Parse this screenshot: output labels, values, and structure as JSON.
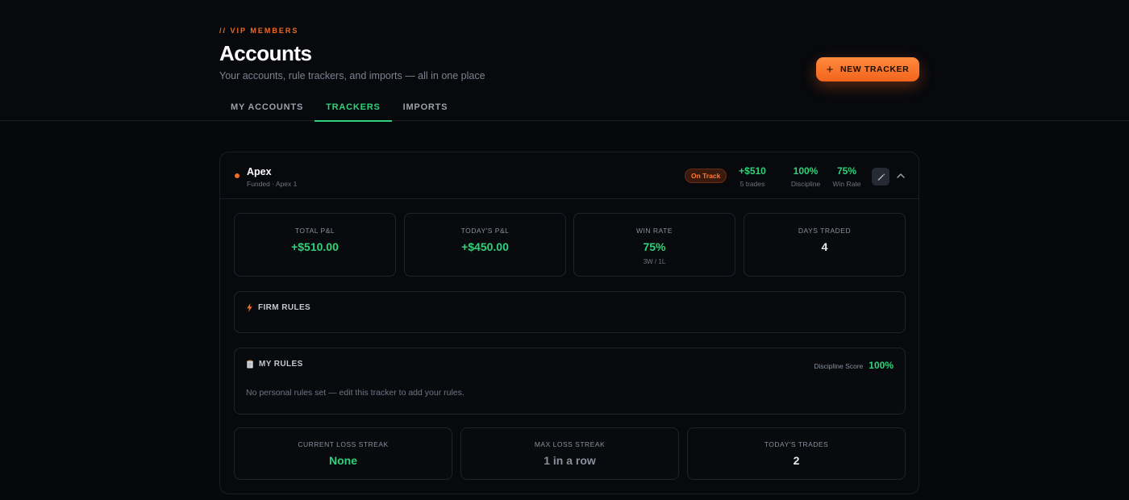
{
  "header": {
    "eyebrow": "// VIP MEMBERS",
    "title": "Accounts",
    "subtitle": "Your accounts, rule trackers, and imports — all in one place",
    "new_tracker_label": "NEW TRACKER",
    "new_tracker_icon": "plus-icon"
  },
  "tabs": [
    {
      "label": "MY ACCOUNTS",
      "active": false
    },
    {
      "label": "TRACKERS",
      "active": true
    },
    {
      "label": "IMPORTS",
      "active": false
    }
  ],
  "tracker": {
    "name": "Apex",
    "sub": "Funded · Apex 1",
    "status_badge": "On Track",
    "header_stats": [
      {
        "value": "+$510",
        "label": "5 trades"
      },
      {
        "value": "100%",
        "label": "Discipline"
      },
      {
        "value": "75%",
        "label": "Win Rate"
      }
    ],
    "summary": [
      {
        "label": "TOTAL P&L",
        "value": "+$510.00",
        "sub": ""
      },
      {
        "label": "TODAY'S P&L",
        "value": "+$450.00",
        "sub": ""
      },
      {
        "label": "WIN RATE",
        "value": "75%",
        "sub": "3W / 1L"
      },
      {
        "label": "DAYS TRADED",
        "value": "4",
        "sub": ""
      }
    ],
    "firm_rules": {
      "title": "FIRM RULES",
      "icon": "lightning-icon"
    },
    "my_rules": {
      "title": "MY RULES",
      "icon": "clipboard-icon",
      "discipline_label": "Discipline Score",
      "discipline_value": "100%",
      "empty_text": "No personal rules set — edit this tracker to add your rules."
    },
    "streaks": [
      {
        "label": "CURRENT LOSS STREAK",
        "value": "None"
      },
      {
        "label": "MAX LOSS STREAK",
        "value": "1 in a row"
      },
      {
        "label": "TODAY'S TRADES",
        "value": "2"
      }
    ]
  },
  "colors": {
    "accent_orange": "#f26b21",
    "positive_green": "#2fd27a",
    "background": "#06080c"
  }
}
